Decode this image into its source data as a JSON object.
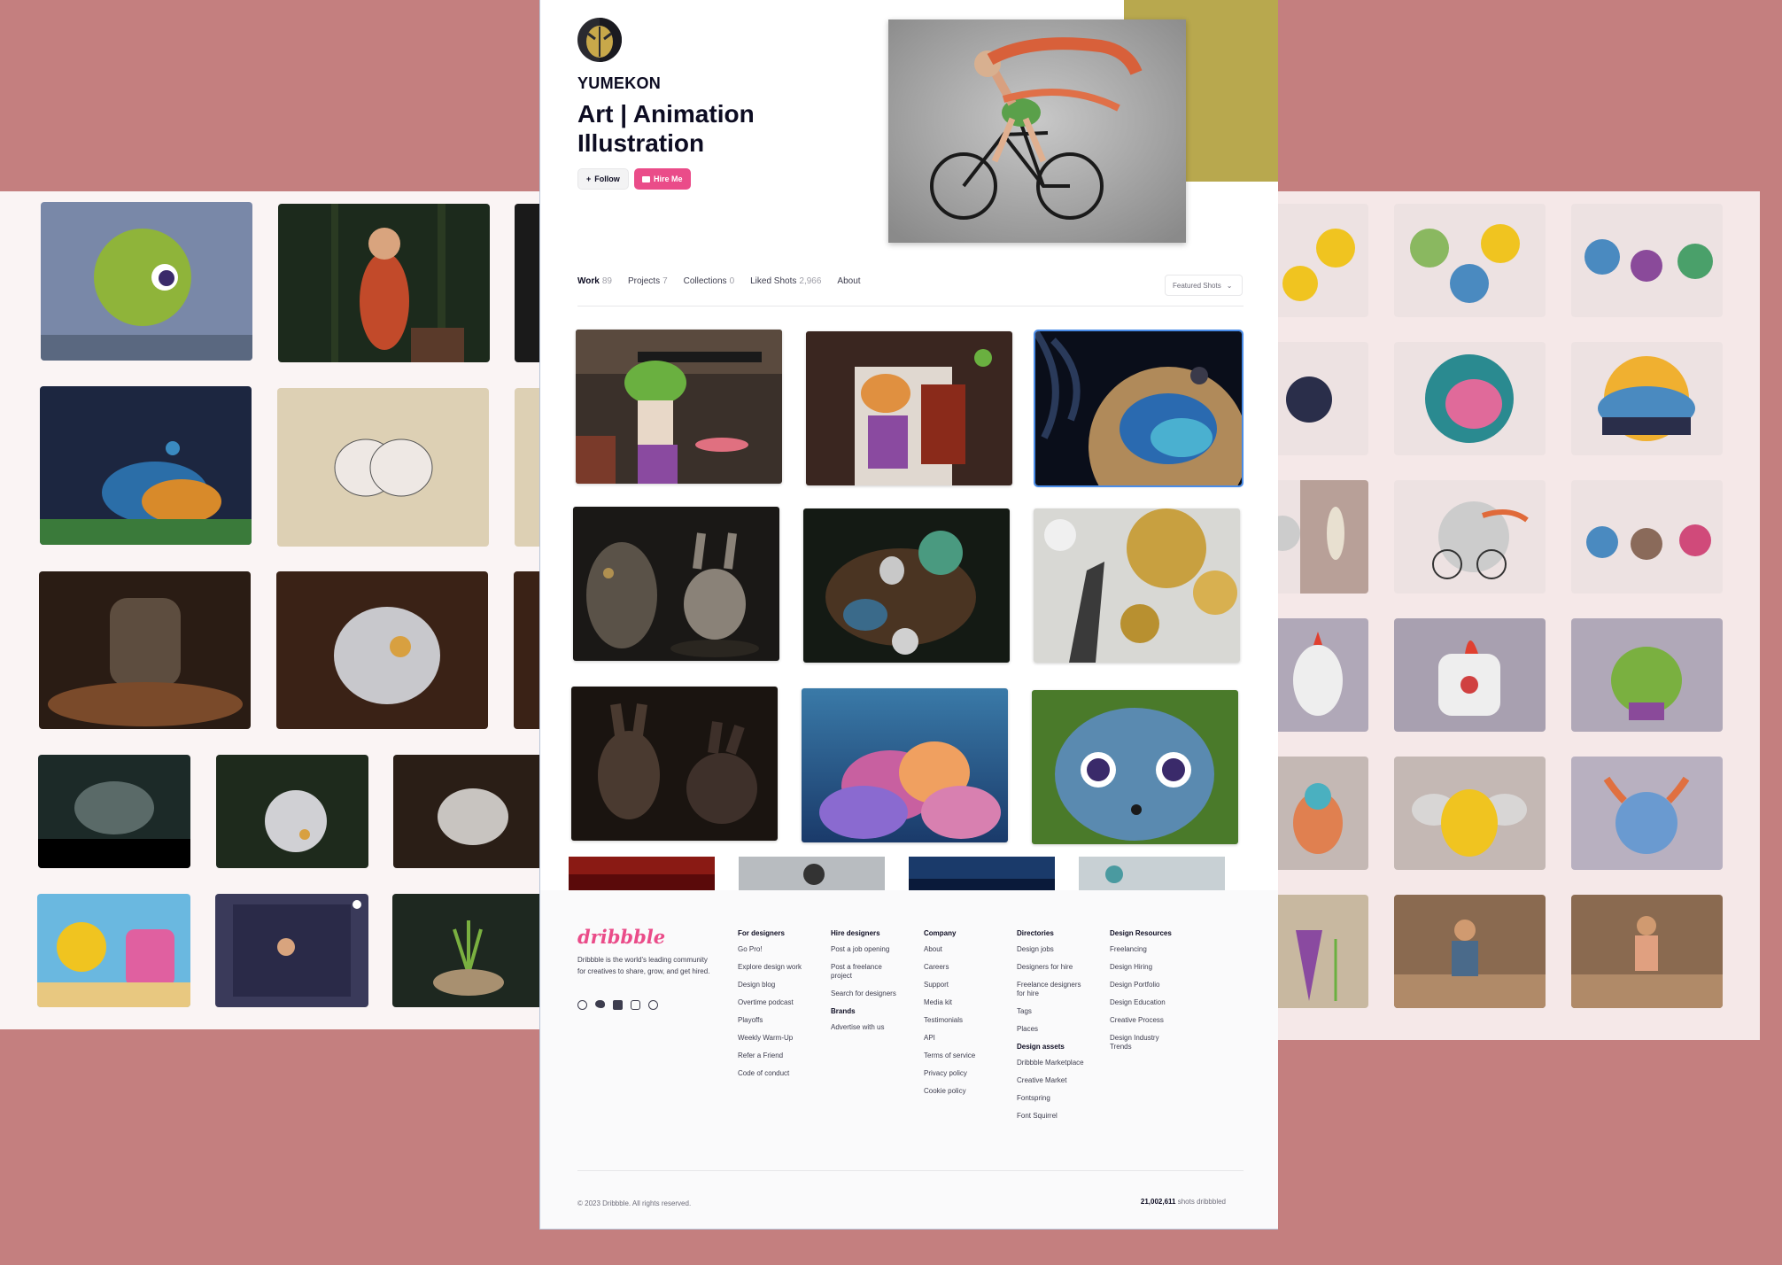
{
  "profile": {
    "name": "YUMEKON",
    "tagline": "Art | Animation Illustration",
    "follow_label": "Follow",
    "hire_label": "Hire Me"
  },
  "tabs": [
    {
      "label": "Work",
      "count": "89"
    },
    {
      "label": "Projects",
      "count": "7"
    },
    {
      "label": "Collections",
      "count": "0"
    },
    {
      "label": "Liked Shots",
      "count": "2,966"
    },
    {
      "label": "About",
      "count": ""
    }
  ],
  "sort": {
    "selected": "Featured Shots"
  },
  "footer": {
    "logo": "dribbble",
    "description": "Dribbble is the world's leading community for creatives to share, grow, and get hired.",
    "columns": [
      {
        "title": "For designers",
        "links": [
          "Go Pro!",
          "Explore design work",
          "Design blog",
          "Overtime podcast",
          "Playoffs",
          "Weekly Warm-Up",
          "Refer a Friend",
          "Code of conduct"
        ]
      },
      {
        "title": "Hire designers",
        "links": [
          "Post a job opening",
          "Post a freelance project",
          "Search for designers"
        ],
        "subtitle": "Brands",
        "sublinks": [
          "Advertise with us"
        ]
      },
      {
        "title": "Company",
        "links": [
          "About",
          "Careers",
          "Support",
          "Media kit",
          "Testimonials",
          "API",
          "Terms of service",
          "Privacy policy",
          "Cookie policy"
        ]
      },
      {
        "title": "Directories",
        "links": [
          "Design jobs",
          "Designers for hire",
          "Freelance designers for hire",
          "Tags",
          "Places"
        ],
        "subtitle": "Design assets",
        "sublinks": [
          "Dribbble Marketplace",
          "Creative Market",
          "Fontspring",
          "Font Squirrel"
        ]
      },
      {
        "title": "Design Resources",
        "links": [
          "Freelancing",
          "Design Hiring",
          "Design Portfolio",
          "Design Education",
          "Creative Process",
          "Design Industry Trends"
        ]
      }
    ],
    "copyright": "© 2023 Dribbble. All rights reserved.",
    "shots_count": "21,002,611",
    "shots_label": "shots dribbbled"
  },
  "colors": {
    "accent": "#ea4c89",
    "background": "#c47f7f",
    "hero_accent": "#b8a84e"
  }
}
